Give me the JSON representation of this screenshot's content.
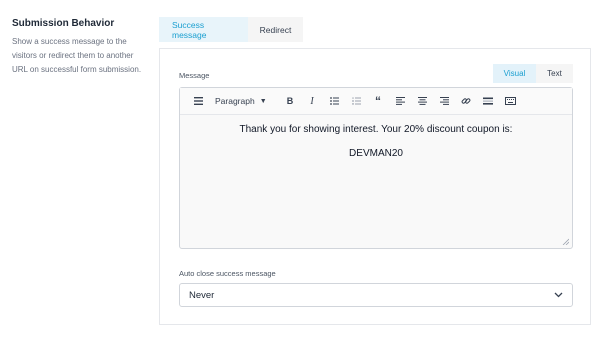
{
  "section": {
    "title": "Submission Behavior",
    "description": "Show a success message to the visitors or redirect them to another URL on successful form submission."
  },
  "tabs": {
    "success": "Success message",
    "redirect": "Redirect"
  },
  "message": {
    "label": "Message",
    "mode_visual": "Visual",
    "mode_text": "Text",
    "format_select": "Paragraph",
    "content_line1": "Thank you for showing interest. Your 20% discount coupon is:",
    "content_line2": "DEVMAN20"
  },
  "auto_close": {
    "label": "Auto close success message",
    "value": "Never"
  },
  "icons": {
    "toolbar": [
      "toolbar-toggle-icon",
      "bold-icon",
      "italic-icon",
      "bullet-list-icon",
      "numbered-list-icon",
      "blockquote-icon",
      "align-left-icon",
      "align-center-icon",
      "align-right-icon",
      "link-icon",
      "horizontal-rule-icon",
      "keyboard-icon"
    ]
  },
  "colors": {
    "accent": "#1a9fd0",
    "accent_bg": "#e8f4fa"
  }
}
